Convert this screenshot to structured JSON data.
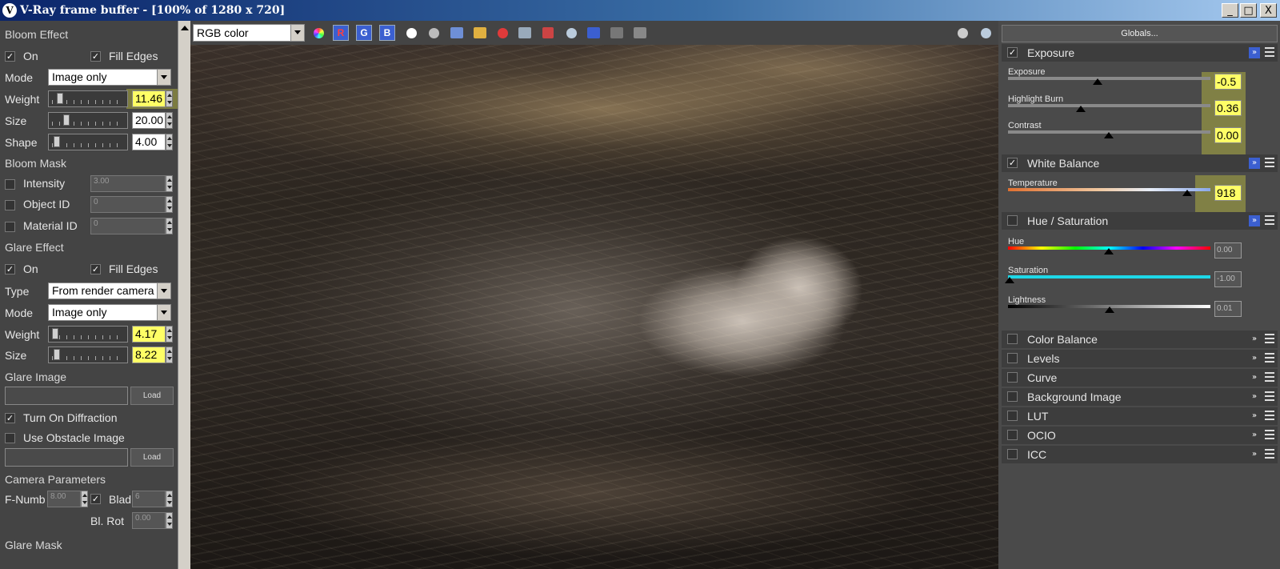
{
  "window": {
    "title": "V-Ray frame buffer - [100% of 1280 x 720]",
    "logo_glyph": "V",
    "controls": {
      "minimize": "_",
      "maximize": "□",
      "close": "X"
    }
  },
  "left_panel": {
    "bloom": {
      "header": "Bloom Effect",
      "on_label": "On",
      "on_checked": true,
      "fill_edges_label": "Fill Edges",
      "fill_edges_checked": true,
      "mode_label": "Mode",
      "mode_value": "Image only",
      "weight_label": "Weight",
      "weight_value": "11.46",
      "size_label": "Size",
      "size_value": "20.00",
      "shape_label": "Shape",
      "shape_value": "4.00"
    },
    "bloom_mask": {
      "header": "Bloom Mask",
      "intensity_label": "Intensity",
      "intensity_value": "3.00",
      "object_id_label": "Object ID",
      "object_id_value": "0",
      "material_id_label": "Material ID",
      "material_id_value": "0"
    },
    "glare": {
      "header": "Glare Effect",
      "on_label": "On",
      "on_checked": true,
      "fill_edges_label": "Fill Edges",
      "fill_edges_checked": true,
      "type_label": "Type",
      "type_value": "From render camera",
      "mode_label": "Mode",
      "mode_value": "Image only",
      "weight_label": "Weight",
      "weight_value": "4.17",
      "size_label": "Size",
      "size_value": "8.22"
    },
    "glare_image": {
      "header": "Glare Image",
      "load_label": "Load",
      "diffraction_label": "Turn On Diffraction",
      "diffraction_checked": true,
      "obstacle_label": "Use Obstacle Image",
      "obstacle_checked": false,
      "load2_label": "Load"
    },
    "camera": {
      "header": "Camera Parameters",
      "fnumber_label": "F-Numb",
      "fnumber_value": "8.00",
      "blades_label": "Blad",
      "blades_checked": true,
      "blades_value": "6",
      "blrot_label": "Bl. Rot",
      "blrot_value": "0.00"
    },
    "glare_mask": {
      "header": "Glare Mask"
    }
  },
  "toolbar": {
    "channel_select": "RGB color",
    "r_label": "R",
    "g_label": "G",
    "b_label": "B",
    "icons": [
      "color-wheel-icon",
      "red-channel",
      "green-channel",
      "blue-channel",
      "white-dot-icon",
      "gray-dot-icon",
      "save-icon",
      "open-folder-icon",
      "clear-icon",
      "duplicate-icon",
      "region-render-icon",
      "teapot-icon",
      "compare-icon",
      "lens-effects-icon",
      "stamp-icon",
      "track-mouse-icon",
      "render-icon"
    ]
  },
  "right_panel": {
    "globals_label": "Globals...",
    "exposure": {
      "title": "Exposure",
      "checked": true,
      "exposure_label": "Exposure",
      "exposure_value": "-0.5",
      "highlight_label": "Highlight Burn",
      "highlight_value": "0.36",
      "contrast_label": "Contrast",
      "contrast_value": "0.00"
    },
    "white_balance": {
      "title": "White Balance",
      "checked": true,
      "temperature_label": "Temperature",
      "temperature_value": "918"
    },
    "hue_saturation": {
      "title": "Hue / Saturation",
      "checked": false,
      "hue_label": "Hue",
      "hue_value": "0.00",
      "saturation_label": "Saturation",
      "saturation_value": "-1.00",
      "lightness_label": "Lightness",
      "lightness_value": "0.01"
    },
    "collapsed_layers": [
      "Color Balance",
      "Levels",
      "Curve",
      "Background Image",
      "LUT",
      "OCIO",
      "ICC"
    ]
  },
  "colors": {
    "highlight": "#ffff66",
    "accent_blue": "#3b5fd0",
    "panel_bg": "#444444"
  }
}
